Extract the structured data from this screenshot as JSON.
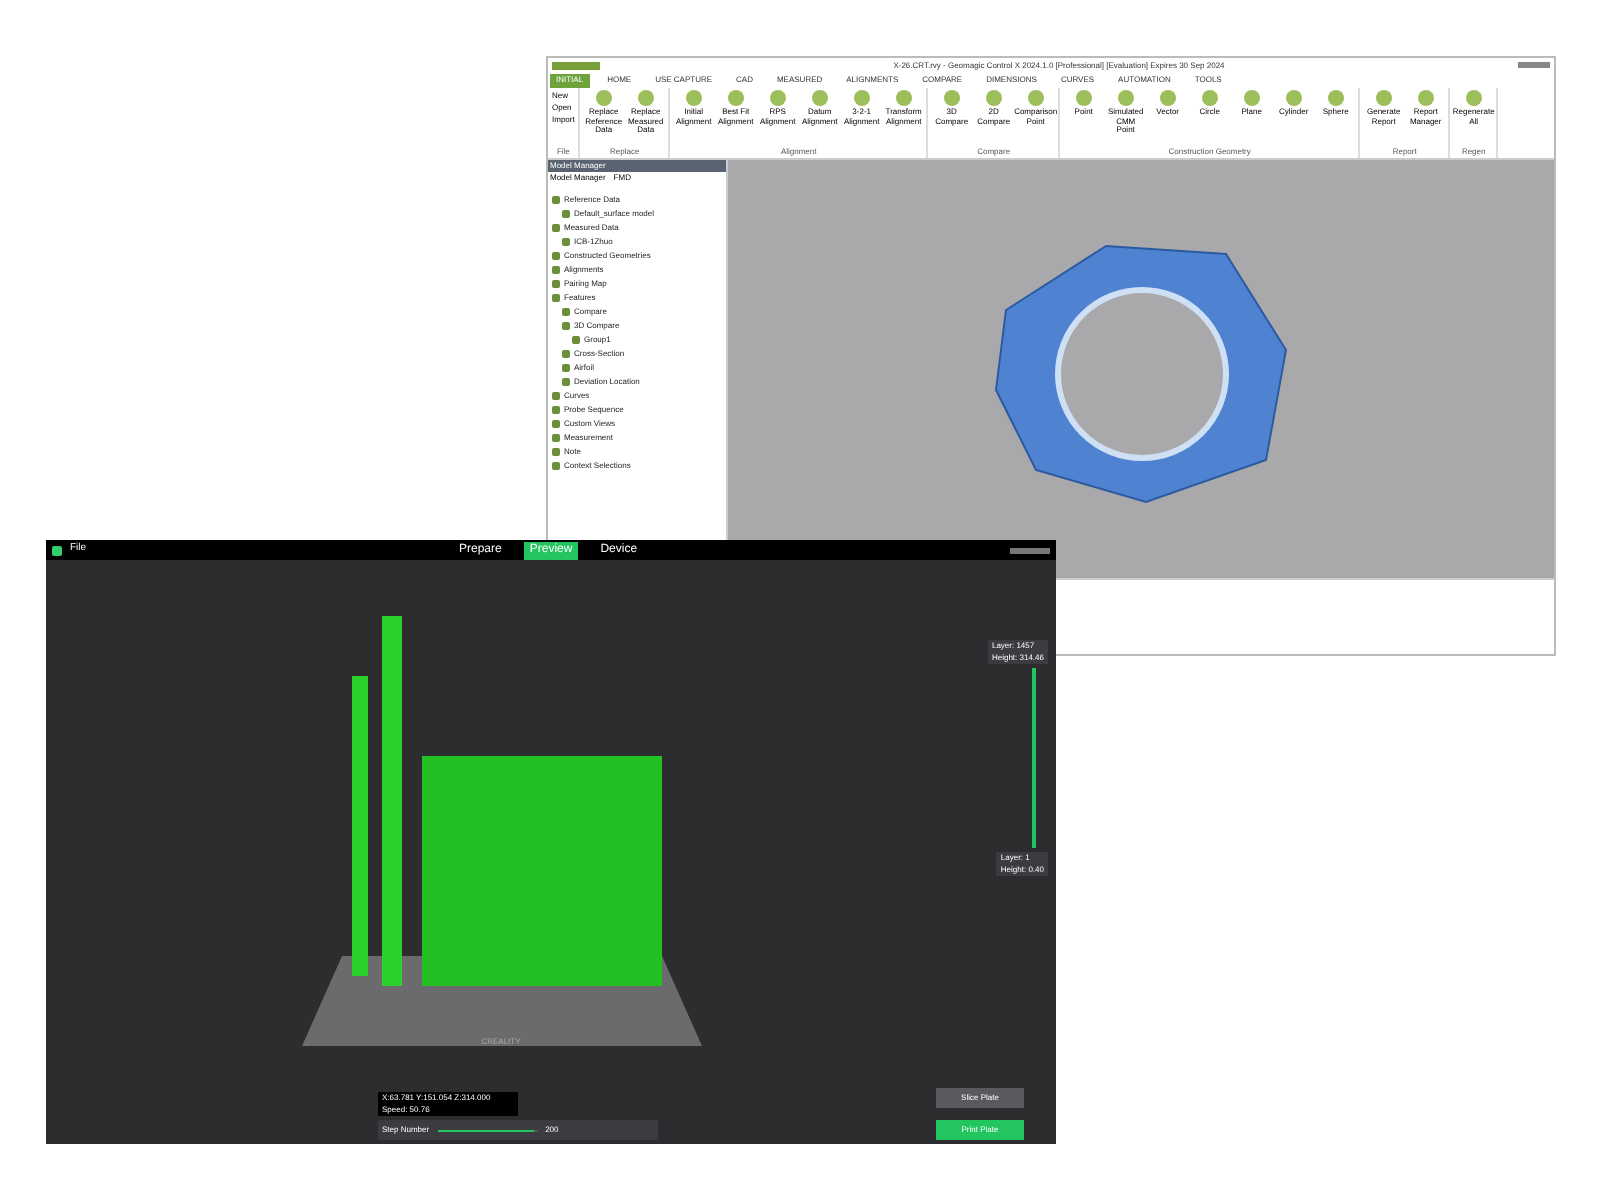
{
  "back_window": {
    "title": "X-26.CRT.rvy - Geomagic Control X 2024.1.0 [Professional] [Evaluation] Expires 30 Sep 2024",
    "tabs": [
      {
        "label": "INITIAL",
        "selected": true
      },
      {
        "label": "HOME",
        "selected": false
      },
      {
        "label": "USE CAPTURE",
        "selected": false
      },
      {
        "label": "CAD",
        "selected": false
      },
      {
        "label": "MEASURED",
        "selected": false
      },
      {
        "label": "ALIGNMENTS",
        "selected": false
      },
      {
        "label": "COMPARE",
        "selected": false
      },
      {
        "label": "DIMENSIONS",
        "selected": false
      },
      {
        "label": "CURVES",
        "selected": false
      },
      {
        "label": "AUTOMATION",
        "selected": false
      },
      {
        "label": "TOOLS",
        "selected": false
      }
    ],
    "file_menu": [
      "New",
      "Open",
      "Import"
    ],
    "ribbon_groups": [
      {
        "label": "File"
      },
      {
        "label": "Replace",
        "buttons": [
          "Replace Reference Data",
          "Replace Measured Data"
        ]
      },
      {
        "label": "Alignment",
        "buttons": [
          "Initial Alignment",
          "Best Fit Alignment",
          "RPS Alignment",
          "Datum Alignment",
          "3-2-1 Alignment",
          "Transform Alignment"
        ]
      },
      {
        "label": "Compare",
        "buttons": [
          "3D Compare",
          "2D Compare",
          "Comparison Point"
        ]
      },
      {
        "label": "Construction Geometry",
        "buttons": [
          "Point",
          "Simulated CMM Point",
          "Vector",
          "Circle",
          "Plane",
          "Cylinder",
          "Sphere"
        ]
      },
      {
        "label": "Report",
        "buttons": [
          "Generate Report",
          "Report Manager"
        ]
      },
      {
        "label": "Regen",
        "buttons": [
          "Regenerate All"
        ]
      }
    ],
    "panel_title": "Model Manager",
    "panel_tabs": [
      "Model Manager",
      "FMD"
    ],
    "tree": [
      {
        "label": "Reference Data",
        "children": [
          {
            "label": "Default_surface model"
          }
        ]
      },
      {
        "label": "Measured Data",
        "children": [
          {
            "label": "ICB-1Zhuo"
          }
        ]
      },
      {
        "label": "Constructed Geometries"
      },
      {
        "label": "Alignments"
      },
      {
        "label": "Pairing Map"
      },
      {
        "label": "Features",
        "children": [
          {
            "label": "Compare"
          },
          {
            "label": "3D Compare",
            "children": [
              {
                "label": "Group1"
              }
            ]
          },
          {
            "label": "Cross-Section"
          },
          {
            "label": "Airfoil"
          },
          {
            "label": "Deviation Location"
          }
        ]
      },
      {
        "label": "Curves"
      },
      {
        "label": "Probe Sequence"
      },
      {
        "label": "Custom Views"
      },
      {
        "label": "Measurement"
      },
      {
        "label": "Note"
      },
      {
        "label": "Context Selections"
      }
    ]
  },
  "front_window": {
    "menu": "File",
    "modes": [
      {
        "label": "Prepare",
        "selected": false
      },
      {
        "label": "Preview",
        "selected": true
      },
      {
        "label": "Device",
        "selected": false
      }
    ],
    "top_layer": [
      "Layer: 1457",
      "Height: 314.46"
    ],
    "bottom_layer": [
      "Layer: 1",
      "Height: 0.40"
    ],
    "plate_brand": "CREALITY",
    "coords": [
      "X:63.781 Y:151.054 Z:314.000",
      "Speed: 50.76"
    ],
    "step": {
      "label": "Step Number",
      "level": 0.97,
      "value": "200"
    },
    "buttons": [
      {
        "label": "Slice Plate",
        "kind": "secondary"
      },
      {
        "label": "Print Plate",
        "kind": "primary"
      }
    ]
  }
}
